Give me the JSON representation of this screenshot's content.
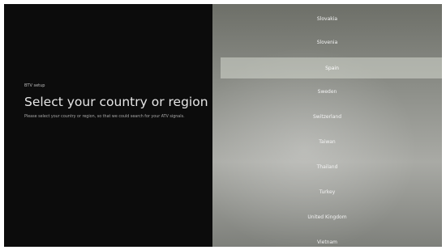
{
  "setup": {
    "section": "BTV setup",
    "title": "Select your country or region",
    "description": "Please select your country or region, so that we could search for your ATV signals."
  },
  "countries": [
    {
      "label": "Slovakia"
    },
    {
      "label": "Slovenia"
    },
    {
      "label": "Spain"
    },
    {
      "label": "Sweden"
    },
    {
      "label": "Switzerland"
    },
    {
      "label": "Taiwan"
    },
    {
      "label": "Thailand"
    },
    {
      "label": "Turkey"
    },
    {
      "label": "United Kingdom"
    },
    {
      "label": "Vietnam"
    }
  ],
  "selected_country": "Spain"
}
